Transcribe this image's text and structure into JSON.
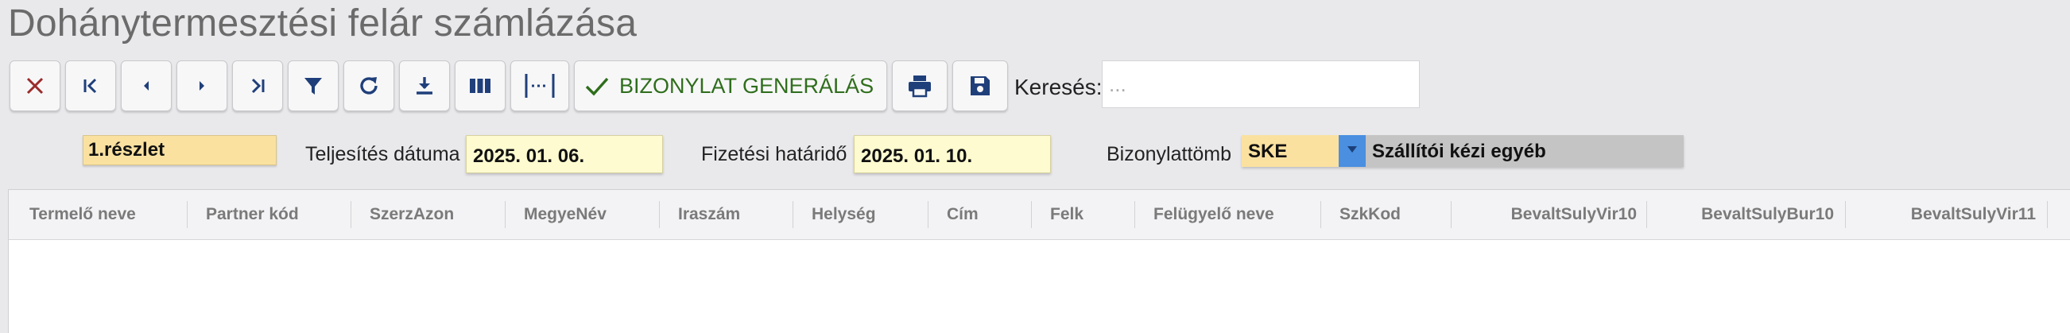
{
  "page": {
    "title": "Dohánytermesztési felár számlázása"
  },
  "toolbar": {
    "buttons": [
      {
        "name": "close-button",
        "icon": "close-icon"
      },
      {
        "name": "first-record-button",
        "icon": "first-icon"
      },
      {
        "name": "prev-record-button",
        "icon": "prev-icon"
      },
      {
        "name": "next-record-button",
        "icon": "next-icon"
      },
      {
        "name": "last-record-button",
        "icon": "last-icon"
      },
      {
        "name": "filter-button",
        "icon": "filter-icon"
      },
      {
        "name": "refresh-button",
        "icon": "refresh-icon"
      },
      {
        "name": "download-button",
        "icon": "download-icon"
      },
      {
        "name": "columns-button",
        "icon": "columns-icon"
      },
      {
        "name": "fit-columns-button",
        "icon": "fit-width-icon"
      },
      {
        "name": "print-button",
        "icon": "print-icon"
      },
      {
        "name": "save-button",
        "icon": "save-icon"
      }
    ],
    "generate_label": "BIZONYLAT GENERÁLÁS",
    "icon_color": "#1f3f7a",
    "close_color": "#9b2b2b",
    "generate_color": "#2f6e1c"
  },
  "search": {
    "label": "Keresés:",
    "placeholder": "...",
    "value": ""
  },
  "form": {
    "installment": "1.részlet",
    "completion_label": "Teljesítés dátuma",
    "completion_value": "2025. 01. 06.",
    "due_label": "Fizetési határidő",
    "due_value": "2025. 01. 10.",
    "voucher_block_label": "Bizonylattömb",
    "voucher_block_code": "SKE",
    "voucher_block_desc": "Szállítói kézi egyéb"
  },
  "grid": {
    "columns": [
      "Termelő neve",
      "Partner kód",
      "SzerzAzon",
      "MegyeNév",
      "Iraszám",
      "Helység",
      "Cím",
      "Felk",
      "Felügyelő neve",
      "SzkKod",
      "BevaltSulyVir10",
      "BevaltSulyBur10",
      "BevaltSulyVir11"
    ],
    "rows": []
  }
}
